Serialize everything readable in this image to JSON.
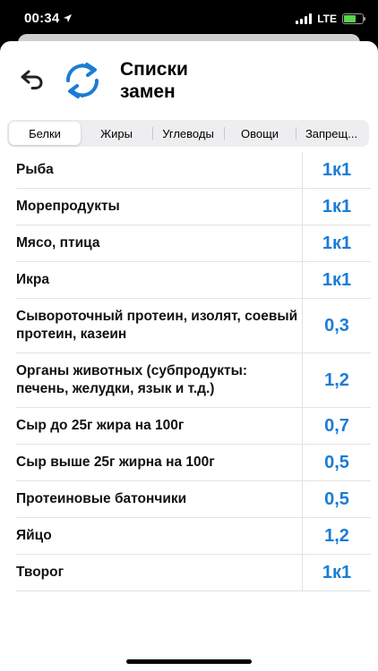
{
  "status_bar": {
    "time": "00:34",
    "network": "LTE",
    "battery_level": 0.65
  },
  "header": {
    "title_line1": "Списки",
    "title_line2": "замен"
  },
  "tabs": [
    {
      "label": "Белки",
      "active": true
    },
    {
      "label": "Жиры",
      "active": false
    },
    {
      "label": "Углеводы",
      "active": false
    },
    {
      "label": "Овощи",
      "active": false
    },
    {
      "label": "Запрещ...",
      "active": false
    }
  ],
  "items": [
    {
      "name": "Рыба",
      "value": "1к1"
    },
    {
      "name": "Морепродукты",
      "value": "1к1"
    },
    {
      "name": "Мясо, птица",
      "value": "1к1"
    },
    {
      "name": "Икра",
      "value": "1к1"
    },
    {
      "name": "Сывороточный протеин, изолят, соевый протеин, казеин",
      "value": "0,3"
    },
    {
      "name": "Органы животных (субпродукты: печень, желудки, язык и т.д.)",
      "value": "1,2"
    },
    {
      "name": "Сыр до 25г жира на 100г",
      "value": "0,7"
    },
    {
      "name": "Сыр выше 25г жирна на 100г",
      "value": "0,5"
    },
    {
      "name": "Протеиновые батончики",
      "value": "0,5"
    },
    {
      "name": "Яйцо",
      "value": "1,2"
    },
    {
      "name": "Творог",
      "value": "1к1"
    }
  ],
  "colors": {
    "accent": "#1b7cd6",
    "battery": "#5ad34f"
  }
}
